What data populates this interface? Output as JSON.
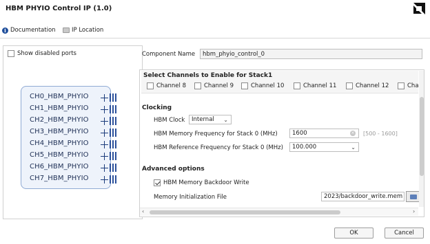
{
  "window": {
    "title": "HBM PHYIO Control IP (1.0)"
  },
  "toolbar": {
    "documentation": "Documentation",
    "ip_location": "IP Location"
  },
  "left_panel": {
    "show_disabled_label": "Show disabled ports",
    "show_disabled_checked": false,
    "ports": [
      "CH0_HBM_PHYIO",
      "CH1_HBM_PHYIO",
      "CH2_HBM_PHYIO",
      "CH3_HBM_PHYIO",
      "CH4_HBM_PHYIO",
      "CH5_HBM_PHYIO",
      "CH6_HBM_PHYIO",
      "CH7_HBM_PHYIO"
    ]
  },
  "component": {
    "label": "Component Name",
    "value": "hbm_phyio_control_0"
  },
  "channels": {
    "title": "Select Channels to Enable for Stack1",
    "items": [
      "Channel 8",
      "Channel 9",
      "Channel 10",
      "Channel 11",
      "Channel 12",
      "Char"
    ]
  },
  "clocking": {
    "title": "Clocking",
    "hbm_clock_label": "HBM Clock",
    "hbm_clock_value": "Internal",
    "mem_freq_label": "HBM Memory Frequency for Stack 0 (MHz)",
    "mem_freq_value": "1600",
    "mem_freq_range": "[500 - 1600]",
    "ref_freq_label": "HBM Reference Frequency for Stack 0 (MHz)",
    "ref_freq_value": "100.000"
  },
  "advanced": {
    "title": "Advanced options",
    "backdoor_label": "HBM Memory Backdoor Write",
    "backdoor_checked": true,
    "init_file_label": "Memory Initialization File",
    "init_file_value": "2023/backdoor_write.mem"
  },
  "buttons": {
    "ok": "OK",
    "cancel": "Cancel"
  }
}
